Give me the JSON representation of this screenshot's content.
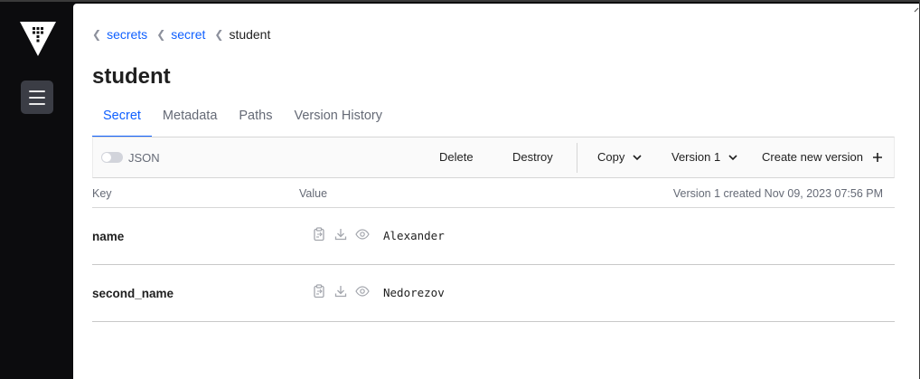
{
  "breadcrumb": [
    {
      "label": "secrets"
    },
    {
      "label": "secret"
    },
    {
      "label": "student"
    }
  ],
  "title": "student",
  "tabs": [
    {
      "label": "Secret",
      "active": true
    },
    {
      "label": "Metadata",
      "active": false
    },
    {
      "label": "Paths",
      "active": false
    },
    {
      "label": "Version History",
      "active": false
    }
  ],
  "toolbar": {
    "json_toggle_label": "JSON",
    "json_toggle_on": false,
    "delete_label": "Delete",
    "destroy_label": "Destroy",
    "copy_label": "Copy",
    "version_label": "Version 1",
    "create_label": "Create new version"
  },
  "table": {
    "col_key": "Key",
    "col_value": "Value",
    "version_info": "Version 1 created Nov 09, 2023 07:56 PM",
    "rows": [
      {
        "key": "name",
        "value": "Alexander"
      },
      {
        "key": "second_name",
        "value": "Nedorezov"
      }
    ]
  },
  "colors": {
    "accent": "#1060ff",
    "sidebar_bg": "#0c0c0e",
    "menu_button_bg": "#3b3d45"
  },
  "icons": [
    "vault-logo-icon",
    "hamburger-menu-icon",
    "clipboard-copy-icon",
    "download-icon",
    "eye-icon",
    "chevron-down-icon",
    "plus-icon",
    "chevron-left-icon"
  ]
}
